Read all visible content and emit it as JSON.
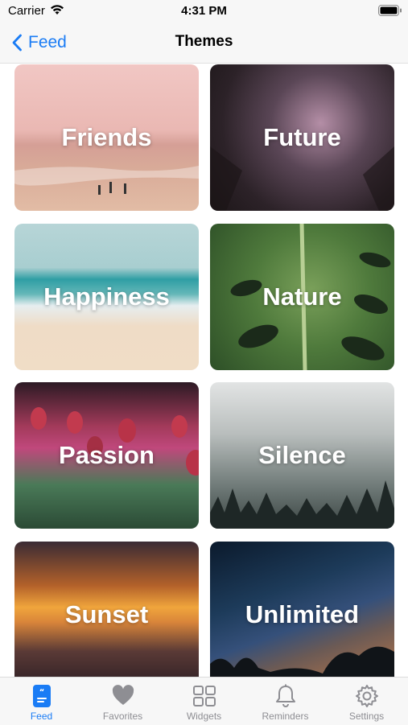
{
  "status_bar": {
    "carrier": "Carrier",
    "time": "4:31 PM"
  },
  "nav": {
    "back_label": "Feed",
    "title": "Themes"
  },
  "themes": [
    {
      "label": "Friends"
    },
    {
      "label": "Future"
    },
    {
      "label": "Happiness"
    },
    {
      "label": "Nature"
    },
    {
      "label": "Passion"
    },
    {
      "label": "Silence"
    },
    {
      "label": "Sunset"
    },
    {
      "label": "Unlimited"
    }
  ],
  "tab_bar": {
    "active": "Feed",
    "tabs": [
      {
        "label": "Feed",
        "icon": "feed-icon"
      },
      {
        "label": "Favorites",
        "icon": "heart-icon"
      },
      {
        "label": "Widgets",
        "icon": "widgets-grid-icon"
      },
      {
        "label": "Reminders",
        "icon": "bell-icon"
      },
      {
        "label": "Settings",
        "icon": "gear-icon"
      }
    ]
  },
  "colors": {
    "accent": "#1a7cf5",
    "inactive": "#8e8e93",
    "bar_background": "#f7f7f7"
  }
}
